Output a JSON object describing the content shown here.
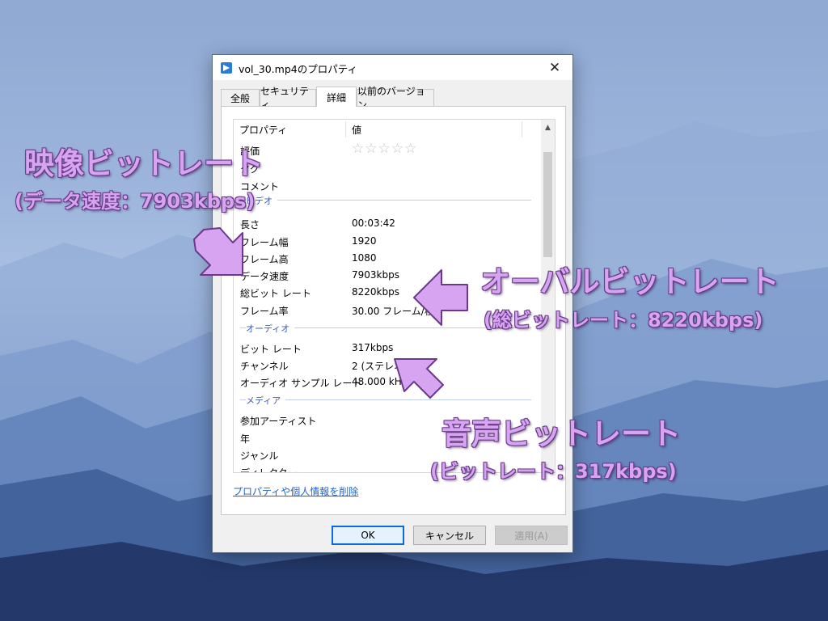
{
  "dialog": {
    "title": "vol_30.mp4のプロパティ",
    "close": "✕",
    "tabs": [
      "全般",
      "セキュリティ",
      "詳細",
      "以前のバージョン"
    ],
    "active_tab": "詳細",
    "columns": {
      "property": "プロパティ",
      "value": "値"
    },
    "rows_top": [
      {
        "key": "評価",
        "value": "☆☆☆☆☆"
      },
      {
        "key": "タグ",
        "value": ""
      },
      {
        "key": "コメント",
        "value": ""
      }
    ],
    "sections": {
      "video": "ビデオ",
      "audio": "オーディオ",
      "media": "メディア"
    },
    "video_rows": [
      {
        "key": "長さ",
        "value": "00:03:42"
      },
      {
        "key": "フレーム幅",
        "value": "1920"
      },
      {
        "key": "フレーム高",
        "value": "1080"
      },
      {
        "key": "データ速度",
        "value": "7903kbps"
      },
      {
        "key": "総ビット レート",
        "value": "8220kbps"
      },
      {
        "key": "フレーム率",
        "value": "30.00 フレーム/秒"
      }
    ],
    "audio_rows": [
      {
        "key": "ビット レート",
        "value": "317kbps"
      },
      {
        "key": "チャンネル",
        "value": "2 (ステレオ)"
      },
      {
        "key": "オーディオ サンプル レート",
        "value": "48.000 kHz"
      }
    ],
    "media_rows": [
      {
        "key": "参加アーティスト",
        "value": ""
      },
      {
        "key": "年",
        "value": ""
      },
      {
        "key": "ジャンル",
        "value": ""
      },
      {
        "key": "ディレクター",
        "value": ""
      }
    ],
    "remove_link": "プロパティや個人情報を削除",
    "buttons": {
      "ok": "OK",
      "cancel": "キャンセル",
      "apply": "適用(A)"
    }
  },
  "annotations": {
    "video_title": "映像ビットレート",
    "video_sub": "(データ速度：7903kbps)",
    "overall_title": "オーバルビットレート",
    "overall_sub": "(総ビットレート：8220kbps)",
    "audio_title": "音声ビットレート",
    "audio_sub": "(ビットレート：317kbps)",
    "color": "#d7a4f2"
  }
}
